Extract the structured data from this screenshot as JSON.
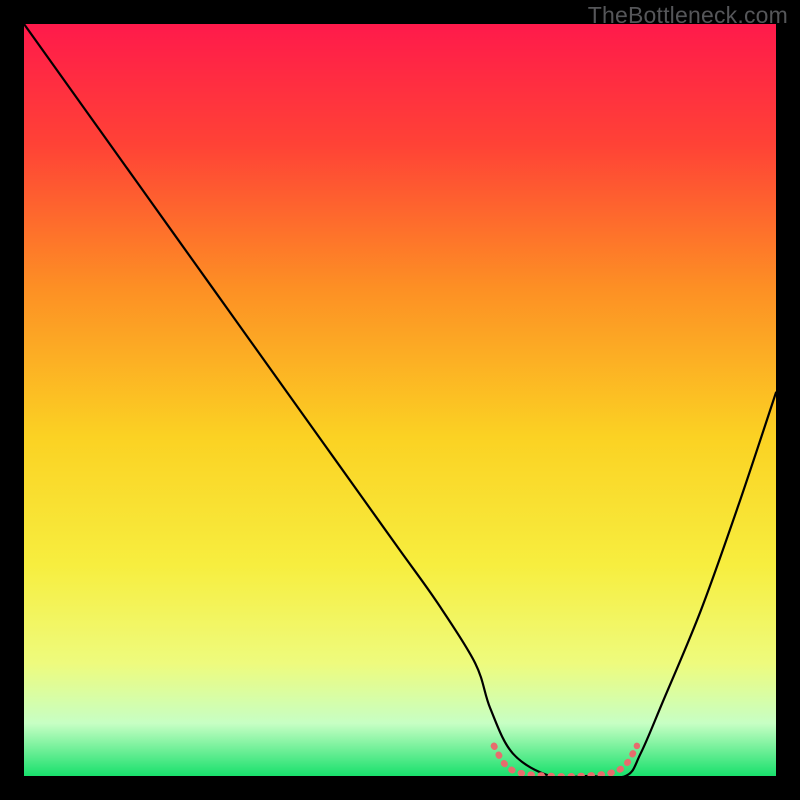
{
  "watermark": "TheBottleneck.com",
  "chart_data": {
    "type": "line",
    "title": "",
    "xlabel": "",
    "ylabel": "",
    "xlim": [
      0,
      100
    ],
    "ylim": [
      0,
      100
    ],
    "grid": false,
    "legend": false,
    "background_gradient": {
      "stops": [
        {
          "offset": 0.0,
          "color": "#ff1a4b"
        },
        {
          "offset": 0.16,
          "color": "#ff4236"
        },
        {
          "offset": 0.35,
          "color": "#fd8f24"
        },
        {
          "offset": 0.55,
          "color": "#fbd223"
        },
        {
          "offset": 0.72,
          "color": "#f7ee3f"
        },
        {
          "offset": 0.85,
          "color": "#eefb7d"
        },
        {
          "offset": 0.93,
          "color": "#c7ffc4"
        },
        {
          "offset": 1.0,
          "color": "#18e06c"
        }
      ]
    },
    "series": [
      {
        "name": "curve",
        "stroke": "#000000",
        "stroke_width": 2.2,
        "x": [
          0,
          5,
          10,
          15,
          20,
          25,
          30,
          35,
          40,
          45,
          50,
          55,
          60,
          62,
          65,
          70,
          75,
          80,
          82,
          85,
          90,
          95,
          100
        ],
        "y": [
          100,
          93,
          86,
          79,
          72,
          65,
          58,
          51,
          44,
          37,
          30,
          23,
          15,
          9,
          3,
          0,
          0,
          0,
          3,
          10,
          22,
          36,
          51
        ]
      }
    ],
    "highlight_segment": {
      "name": "valley-highlight",
      "stroke": "#e76d6d",
      "stroke_width": 6.5,
      "linecap": "round",
      "x": [
        62.5,
        64,
        66,
        70,
        74,
        78,
        80,
        81.5
      ],
      "y": [
        4.0,
        1.5,
        0.4,
        0.0,
        0.0,
        0.4,
        1.5,
        4.0
      ]
    }
  }
}
